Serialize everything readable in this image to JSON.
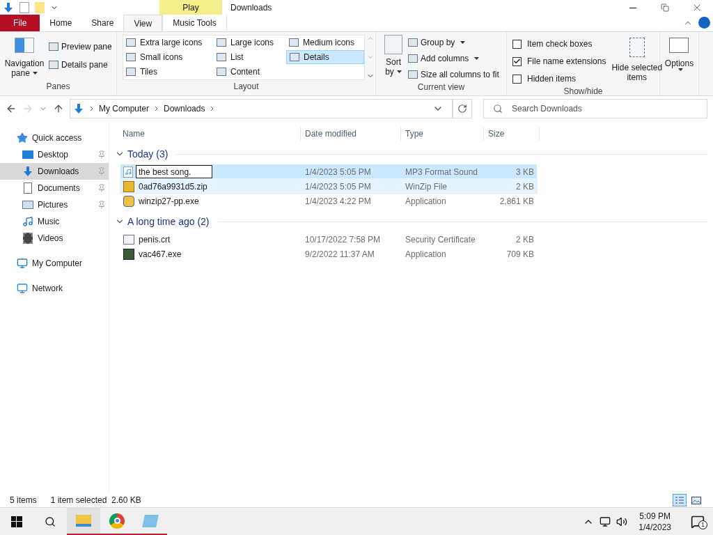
{
  "window": {
    "title": "Downloads",
    "context_tab_group": "Play"
  },
  "ribbon_tabs": [
    {
      "label": "File",
      "kind": "file",
      "selected": false
    },
    {
      "label": "Home",
      "kind": "tab",
      "selected": false
    },
    {
      "label": "Share",
      "kind": "tab",
      "selected": false
    },
    {
      "label": "View",
      "kind": "tab",
      "selected": true
    },
    {
      "label": "Music Tools",
      "kind": "context",
      "selected": false
    }
  ],
  "panes": {
    "title": "Panes",
    "navigation_pane": [
      "Navigation",
      "pane"
    ],
    "items": [
      "Preview pane",
      "Details pane"
    ]
  },
  "layout": {
    "title": "Layout",
    "options": [
      {
        "label": "Extra large icons",
        "selected": false
      },
      {
        "label": "Small icons",
        "selected": false
      },
      {
        "label": "Tiles",
        "selected": false
      },
      {
        "label": "Large icons",
        "selected": false
      },
      {
        "label": "List",
        "selected": false
      },
      {
        "label": "Content",
        "selected": false
      },
      {
        "label": "Medium icons",
        "selected": false
      },
      {
        "label": "Details",
        "selected": true
      }
    ]
  },
  "current_view": {
    "title": "Current view",
    "sort_by": [
      "Sort",
      "by"
    ],
    "items": [
      "Group by",
      "Add columns",
      "Size all columns to fit"
    ]
  },
  "show_hide": {
    "title": "Show/hide",
    "checkboxes": [
      {
        "label": "Item check boxes",
        "checked": false
      },
      {
        "label": "File name extensions",
        "checked": true
      },
      {
        "label": "Hidden items",
        "checked": false
      }
    ],
    "hide_selected": [
      "Hide selected",
      "items"
    ]
  },
  "options": {
    "label": "Options"
  },
  "address_bar": {
    "path": [
      "My Computer",
      "Downloads"
    ]
  },
  "search": {
    "placeholder": "Search Downloads"
  },
  "navigation": [
    {
      "label": "Quick access",
      "kind": "star",
      "selected": false,
      "children": [
        {
          "label": "Desktop",
          "kind": "desktop",
          "selected": false,
          "pinned": true
        },
        {
          "label": "Downloads",
          "kind": "download",
          "selected": true,
          "pinned": true
        },
        {
          "label": "Documents",
          "kind": "documents",
          "selected": false,
          "pinned": true
        },
        {
          "label": "Pictures",
          "kind": "pictures",
          "selected": false,
          "pinned": true
        },
        {
          "label": "Music",
          "kind": "music",
          "selected": false,
          "pinned": false
        },
        {
          "label": "Videos",
          "kind": "videos",
          "selected": false,
          "pinned": false
        }
      ]
    },
    {
      "label": "My Computer",
      "kind": "computer",
      "selected": false
    },
    {
      "label": "Network",
      "kind": "network",
      "selected": false
    }
  ],
  "columns": [
    "Name",
    "Date modified",
    "Type",
    "Size"
  ],
  "groups": [
    {
      "title": "Today (3)",
      "expanded": true,
      "rows": [
        {
          "name": "the best song.",
          "kind": "audio",
          "renaming": true,
          "selected": true,
          "hovered": false,
          "date": "1/4/2023 5:05 PM",
          "type": "MP3 Format Sound",
          "size": "3 KB"
        },
        {
          "name": "0ad76a9931d5.zip",
          "kind": "zip",
          "renaming": false,
          "selected": false,
          "hovered": true,
          "date": "1/4/2023 5:05 PM",
          "type": "WinZip File",
          "size": "2 KB"
        },
        {
          "name": "winzip27-pp.exe",
          "kind": "installer",
          "renaming": false,
          "selected": false,
          "hovered": false,
          "date": "1/4/2023 4:22 PM",
          "type": "Application",
          "size": "2,861 KB"
        }
      ]
    },
    {
      "title": "A long time ago (2)",
      "expanded": true,
      "rows": [
        {
          "name": "penis.crt",
          "kind": "certificate",
          "renaming": false,
          "selected": false,
          "hovered": false,
          "date": "10/17/2022 7:58 PM",
          "type": "Security Certificate",
          "size": "2 KB"
        },
        {
          "name": "vac467.exe",
          "kind": "app",
          "renaming": false,
          "selected": false,
          "hovered": false,
          "date": "9/2/2022 11:37 AM",
          "type": "Application",
          "size": "709 KB"
        }
      ]
    }
  ],
  "status_bar": {
    "count": "5 items",
    "selection": "1 item selected  2.60 KB",
    "views": [
      {
        "kind": "details",
        "selected": true
      },
      {
        "kind": "thumbnails",
        "selected": false
      }
    ]
  },
  "taskbar": {
    "apps": [
      {
        "kind": "explorer",
        "running": true
      },
      {
        "kind": "chrome",
        "running": true
      },
      {
        "kind": "notepad",
        "running": true
      }
    ],
    "time": "5:09 PM",
    "date": "1/4/2023",
    "notifications": "1"
  }
}
